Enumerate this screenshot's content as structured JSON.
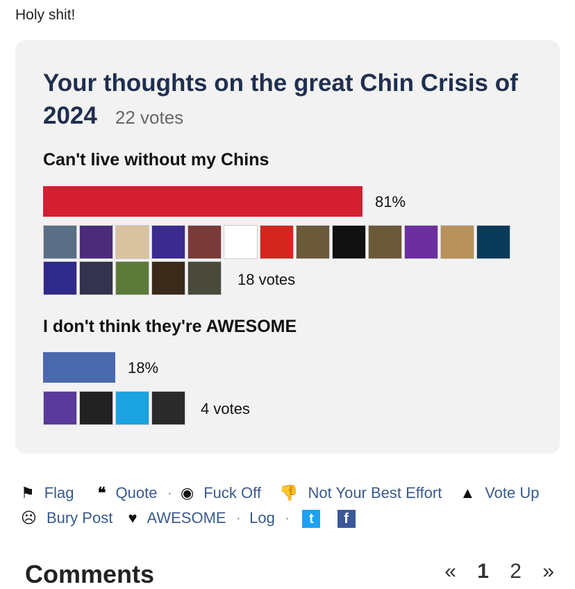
{
  "post": {
    "text": "Holy shit!"
  },
  "poll": {
    "title": "Your thoughts on the great Chin Crisis of 2024",
    "total_votes": "22 votes",
    "options": [
      {
        "label": "Can't live without my Chins",
        "percent_label": "81%",
        "percent": 81,
        "votes_label": "18 votes",
        "color": "#d41f33",
        "avatars": [
          "photo",
          "husky",
          "glasses-face",
          "purple-cap",
          "red-cap",
          "paw-w",
          "red-face",
          "photo-man",
          "zappa",
          "photo-man",
          "magic-moron",
          "mask",
          "kraken",
          "fish",
          "drink-bleach",
          "penguin",
          "man-face",
          "football"
        ]
      },
      {
        "label": "I don't think they're AWESOME",
        "percent_label": "18%",
        "percent": 18,
        "votes_label": "4 votes",
        "color": "#4b6aad",
        "avatars": [
          "football-purple",
          "shirt",
          "big-ten",
          "man-lights"
        ]
      }
    ]
  },
  "actions": {
    "flag": "Flag",
    "quote": "Quote",
    "fuck_off": "Fuck Off",
    "not_best": "Not Your Best Effort",
    "vote_up": "Vote Up",
    "bury": "Bury Post",
    "awesome": "AWESOME",
    "log": "Log",
    "sep": "·"
  },
  "comments": {
    "heading": "Comments",
    "pages": [
      "«",
      "1",
      "2",
      "»"
    ]
  },
  "colors": {
    "accent": "#3a5a8f",
    "title": "#1f2f4f",
    "bar_red": "#d41f33",
    "bar_blue": "#4b6aad"
  }
}
